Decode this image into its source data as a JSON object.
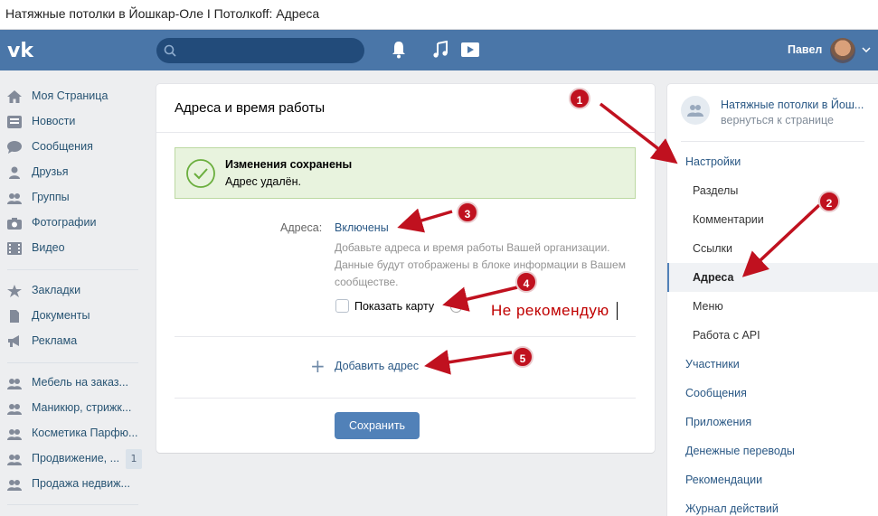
{
  "window": {
    "title": "Натяжные потолки в Йошкар-Оле I Потолкoff: Адреса"
  },
  "header": {
    "user_name": "Павел"
  },
  "left_nav": {
    "items": [
      {
        "label": "Моя Страница",
        "icon": "home-icon"
      },
      {
        "label": "Новости",
        "icon": "news-icon"
      },
      {
        "label": "Сообщения",
        "icon": "messages-icon"
      },
      {
        "label": "Друзья",
        "icon": "friends-icon"
      },
      {
        "label": "Группы",
        "icon": "groups-icon"
      },
      {
        "label": "Фотографии",
        "icon": "camera-icon"
      },
      {
        "label": "Видео",
        "icon": "video-icon"
      },
      {
        "label": "Закладки",
        "icon": "star-icon"
      },
      {
        "label": "Документы",
        "icon": "document-icon"
      },
      {
        "label": "Реклама",
        "icon": "megaphone-icon"
      },
      {
        "label": "Мебель на заказ...",
        "icon": "group-icon"
      },
      {
        "label": "Маникюр, стрижк...",
        "icon": "group-icon"
      },
      {
        "label": "Косметика Парфю...",
        "icon": "group-icon"
      },
      {
        "label": "Продвижение, ...",
        "icon": "group-icon",
        "badge": "1"
      },
      {
        "label": "Продажа недвиж...",
        "icon": "group-icon"
      }
    ]
  },
  "main": {
    "title": "Адреса и время работы",
    "success": {
      "title": "Изменения сохранены",
      "text": "Адрес удалён."
    },
    "addresses_label": "Адреса:",
    "addresses_value": "Включены",
    "description": "Добавьте адреса и время работы Вашей организации. Данные будут отображены в блоке информации в Вашем сообществе.",
    "show_map_label": "Показать карту",
    "add_address": "Добавить адрес",
    "save_button": "Сохранить"
  },
  "annotation": {
    "text": "Не рекомендую",
    "numbers": [
      "1",
      "2",
      "3",
      "4",
      "5"
    ],
    "color": "#c00000"
  },
  "right_menu": {
    "group_name": "Натяжные потолки в Йош...",
    "back_link": "вернуться к странице",
    "items": [
      {
        "label": "Настройки",
        "level": "top"
      },
      {
        "label": "Разделы",
        "level": "sub"
      },
      {
        "label": "Комментарии",
        "level": "sub"
      },
      {
        "label": "Ссылки",
        "level": "sub"
      },
      {
        "label": "Адреса",
        "level": "sub",
        "active": true
      },
      {
        "label": "Меню",
        "level": "sub"
      },
      {
        "label": "Работа с API",
        "level": "sub"
      },
      {
        "label": "Участники",
        "level": "top"
      },
      {
        "label": "Сообщения",
        "level": "top"
      },
      {
        "label": "Приложения",
        "level": "top"
      },
      {
        "label": "Денежные переводы",
        "level": "top"
      },
      {
        "label": "Рекомендации",
        "level": "top"
      },
      {
        "label": "Журнал действий",
        "level": "top"
      }
    ]
  },
  "colors": {
    "header": "#4a76a8",
    "link": "#2a5885",
    "button": "#5181b8",
    "success_bg": "#e8f3de"
  }
}
